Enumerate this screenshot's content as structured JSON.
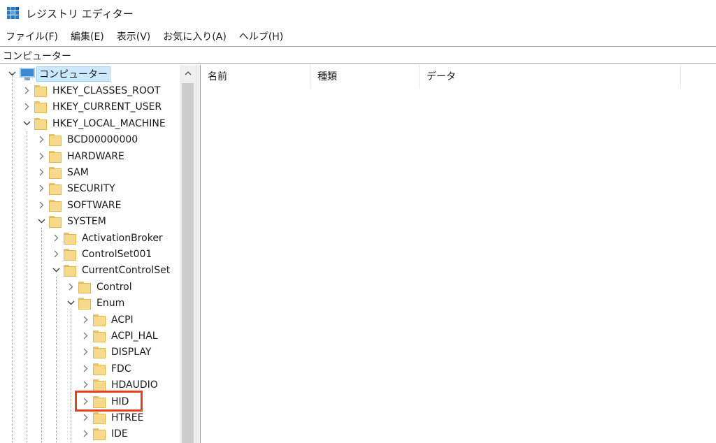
{
  "window": {
    "title": "レジストリ エディター",
    "icon": "registry-editor-icon"
  },
  "menu": [
    {
      "label": "ファイル(F)"
    },
    {
      "label": "編集(E)"
    },
    {
      "label": "表示(V)"
    },
    {
      "label": "お気に入り(A)"
    },
    {
      "label": "ヘルプ(H)"
    }
  ],
  "address": {
    "path": "コンピューター"
  },
  "tree": {
    "root": {
      "label": "コンピューター",
      "expanded": true,
      "selected": true
    },
    "nodes": [
      {
        "label": "HKEY_CLASSES_ROOT",
        "level": 1,
        "expanded": false
      },
      {
        "label": "HKEY_CURRENT_USER",
        "level": 1,
        "expanded": false
      },
      {
        "label": "HKEY_LOCAL_MACHINE",
        "level": 1,
        "expanded": true
      },
      {
        "label": "BCD00000000",
        "level": 2,
        "expanded": false
      },
      {
        "label": "HARDWARE",
        "level": 2,
        "expanded": false
      },
      {
        "label": "SAM",
        "level": 2,
        "expanded": false
      },
      {
        "label": "SECURITY",
        "level": 2,
        "expanded": false
      },
      {
        "label": "SOFTWARE",
        "level": 2,
        "expanded": false
      },
      {
        "label": "SYSTEM",
        "level": 2,
        "expanded": true
      },
      {
        "label": "ActivationBroker",
        "level": 3,
        "expanded": false
      },
      {
        "label": "ControlSet001",
        "level": 3,
        "expanded": false
      },
      {
        "label": "CurrentControlSet",
        "level": 3,
        "expanded": true
      },
      {
        "label": "Control",
        "level": 4,
        "expanded": false
      },
      {
        "label": "Enum",
        "level": 4,
        "expanded": true
      },
      {
        "label": "ACPI",
        "level": 5,
        "expanded": false
      },
      {
        "label": "ACPI_HAL",
        "level": 5,
        "expanded": false
      },
      {
        "label": "DISPLAY",
        "level": 5,
        "expanded": false
      },
      {
        "label": "FDC",
        "level": 5,
        "expanded": false
      },
      {
        "label": "HDAUDIO",
        "level": 5,
        "expanded": false
      },
      {
        "label": "HID",
        "level": 5,
        "expanded": false,
        "highlighted": true
      },
      {
        "label": "HTREE",
        "level": 5,
        "expanded": false
      },
      {
        "label": "IDE",
        "level": 5,
        "expanded": false
      }
    ]
  },
  "list": {
    "columns": [
      {
        "label": "名前"
      },
      {
        "label": "種類"
      },
      {
        "label": "データ"
      }
    ]
  },
  "colors": {
    "highlight_box": "#e8401c",
    "selection_bg": "#cce8ff",
    "folder": "#f7d98b"
  }
}
